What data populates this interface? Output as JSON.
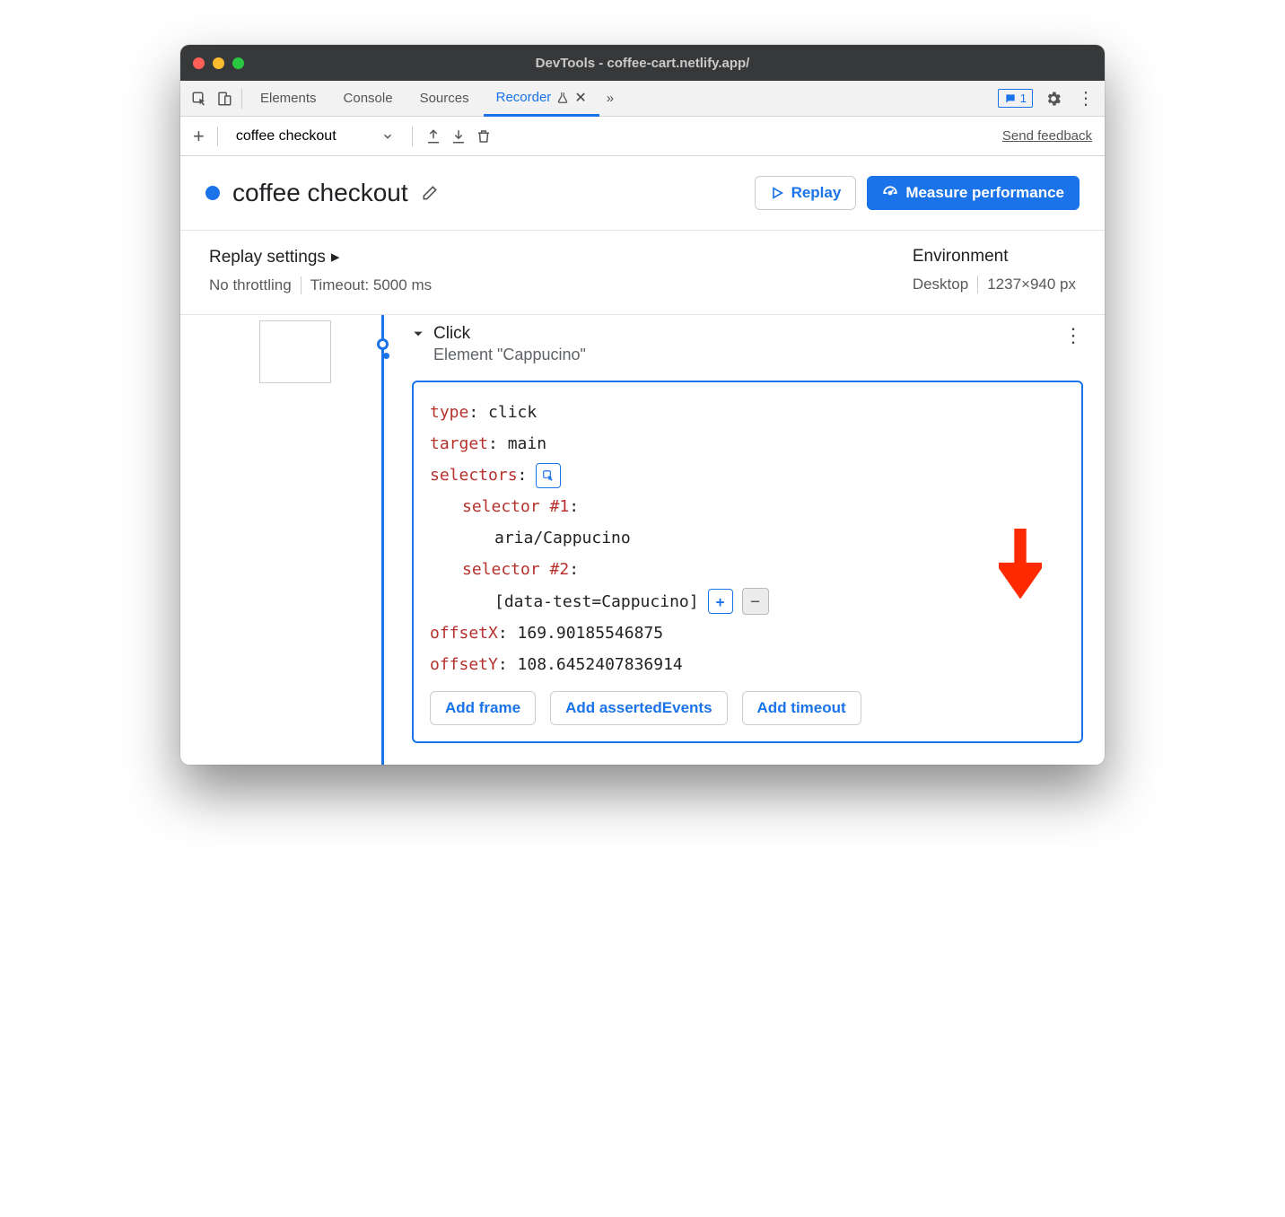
{
  "window": {
    "title": "DevTools - coffee-cart.netlify.app/"
  },
  "tabs": {
    "elements": "Elements",
    "console": "Console",
    "sources": "Sources",
    "recorder": "Recorder",
    "more": "»"
  },
  "issues": {
    "count": "1"
  },
  "toolbar": {
    "recording_select": "coffee checkout",
    "send_feedback": "Send feedback"
  },
  "header": {
    "title": "coffee checkout",
    "replay": "Replay",
    "measure": "Measure performance"
  },
  "settings": {
    "replay_title": "Replay settings",
    "throttle": "No throttling",
    "timeout": "Timeout: 5000 ms",
    "env_title": "Environment",
    "device": "Desktop",
    "dims": "1237×940 px"
  },
  "step": {
    "title": "Click",
    "subtitle": "Element \"Cappucino\"",
    "line_type_k": "type",
    "line_type_v": ": click",
    "line_target_k": "target",
    "line_target_v": ": main",
    "line_selectors_k": "selectors",
    "line_selectors_v": ":",
    "sel1_k": "selector #1",
    "sel1_v": ":",
    "sel1_val": "aria/Cappucino",
    "sel2_k": "selector #2",
    "sel2_v": ":",
    "sel2_val": "[data-test=Cappucino]",
    "ox_k": "offsetX",
    "ox_v": ": 169.90185546875",
    "oy_k": "offsetY",
    "oy_v": ": 108.6452407836914",
    "add_frame": "Add frame",
    "add_asserted": "Add assertedEvents",
    "add_timeout": "Add timeout"
  }
}
